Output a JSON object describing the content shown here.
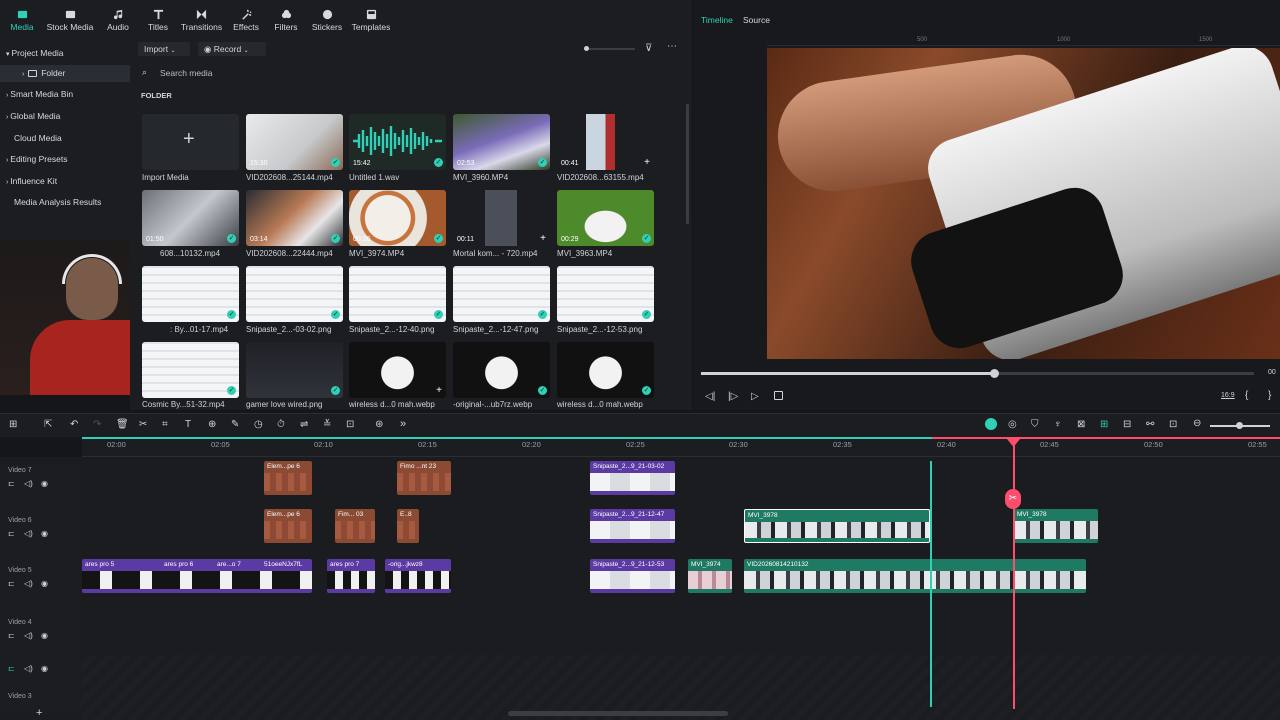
{
  "toolbar": {
    "tabs": [
      {
        "label": "Media",
        "icon": "media-icon"
      },
      {
        "label": "Stock Media",
        "icon": "stock-media-icon"
      },
      {
        "label": "Audio",
        "icon": "audio-icon"
      },
      {
        "label": "Titles",
        "icon": "titles-icon"
      },
      {
        "label": "Transitions",
        "icon": "transitions-icon"
      },
      {
        "label": "Effects",
        "icon": "effects-icon"
      },
      {
        "label": "Filters",
        "icon": "filters-icon"
      },
      {
        "label": "Stickers",
        "icon": "stickers-icon"
      },
      {
        "label": "Templates",
        "icon": "templates-icon"
      }
    ]
  },
  "tree": {
    "items": [
      "Project Media",
      "Folder",
      "Smart Media Bin",
      "Global Media",
      "Cloud Media",
      "Editing Presets",
      "Influence Kit",
      "Media Analysis Results"
    ]
  },
  "media": {
    "import_label": "Import",
    "record_label": "Record",
    "search_placeholder": "Search media",
    "folder_heading": "FOLDER",
    "import_tile_label": "Import Media",
    "items": [
      {
        "name": "VID202608...25144.mp4",
        "duration": "15:30"
      },
      {
        "name": "Untitled 1.wav",
        "duration": "15:42"
      },
      {
        "name": "MVI_3960.MP4",
        "duration": "02:53"
      },
      {
        "name": "VID202608...63155.mp4",
        "duration": "00:41"
      },
      {
        "name": "608...10132.mp4",
        "duration": "01:50"
      },
      {
        "name": "VID202608...22444.mp4",
        "duration": "03:14"
      },
      {
        "name": "MVI_3974.MP4",
        "duration": "00:26"
      },
      {
        "name": "Mortal kom... - 720.mp4",
        "duration": "00:11"
      },
      {
        "name": "MVI_3963.MP4",
        "duration": "00:29"
      },
      {
        "name": ": By...01-17.mp4",
        "duration": ""
      },
      {
        "name": "Snipaste_2...-03-02.png",
        "duration": ""
      },
      {
        "name": "Snipaste_2...-12-40.png",
        "duration": ""
      },
      {
        "name": "Snipaste_2...-12-47.png",
        "duration": ""
      },
      {
        "name": "Snipaste_2...-12-53.png",
        "duration": ""
      },
      {
        "name": "Cosmic By...51-32.mp4",
        "duration": ""
      },
      {
        "name": "gamer love wired.png",
        "duration": ""
      },
      {
        "name": "wireless d...0 mah.webp",
        "duration": ""
      },
      {
        "name": "-original-...ub7rz.webp",
        "duration": ""
      },
      {
        "name": "wireless d...0 mah.webp",
        "duration": ""
      }
    ]
  },
  "player": {
    "tab_timeline": "Timeline",
    "tab_source": "Source",
    "ruler_ticks": [
      "500",
      "1000",
      "1500"
    ],
    "time_display": "00",
    "aspect": "16:9",
    "progress": 0.53
  },
  "timeline": {
    "ruler": [
      "02:00",
      "02:05",
      "02:10",
      "02:15",
      "02:20",
      "02:25",
      "02:30",
      "02:35",
      "02:40",
      "02:45",
      "02:50",
      "02:55"
    ],
    "tracks": [
      "Video 7",
      "Video 6",
      "Video 5",
      "Video 4",
      "Video 3"
    ],
    "clips": {
      "v7_a": "Elem...pe 6",
      "v7_b": "Fimo ...nt 23",
      "v7_c": "Snipaste_2...9_21-03-02",
      "v6_a": "Elem...pe 6",
      "v6_b": "Fim... 03",
      "v6_c": "E..8",
      "v6_d": "Snipaste_2...9_21-12-47",
      "v6_e": "MVI_3978",
      "v6_f": "MVI_3978",
      "v5_a": "ares pro 5",
      "v5_b": "ares pro 6",
      "v5_c": "are...o 7",
      "v5_d": "51oeeNJx7fL",
      "v5_e": "ares pro 7",
      "v5_f": "-orig...jkwz8",
      "v5_g": "Snipaste_2...9_21-12-53",
      "v5_h": "MVI_3974",
      "v5_i": "VID20260814210132"
    },
    "colors": {
      "playhead": "#ff4d6d",
      "marker": "#2fd0b5"
    }
  }
}
